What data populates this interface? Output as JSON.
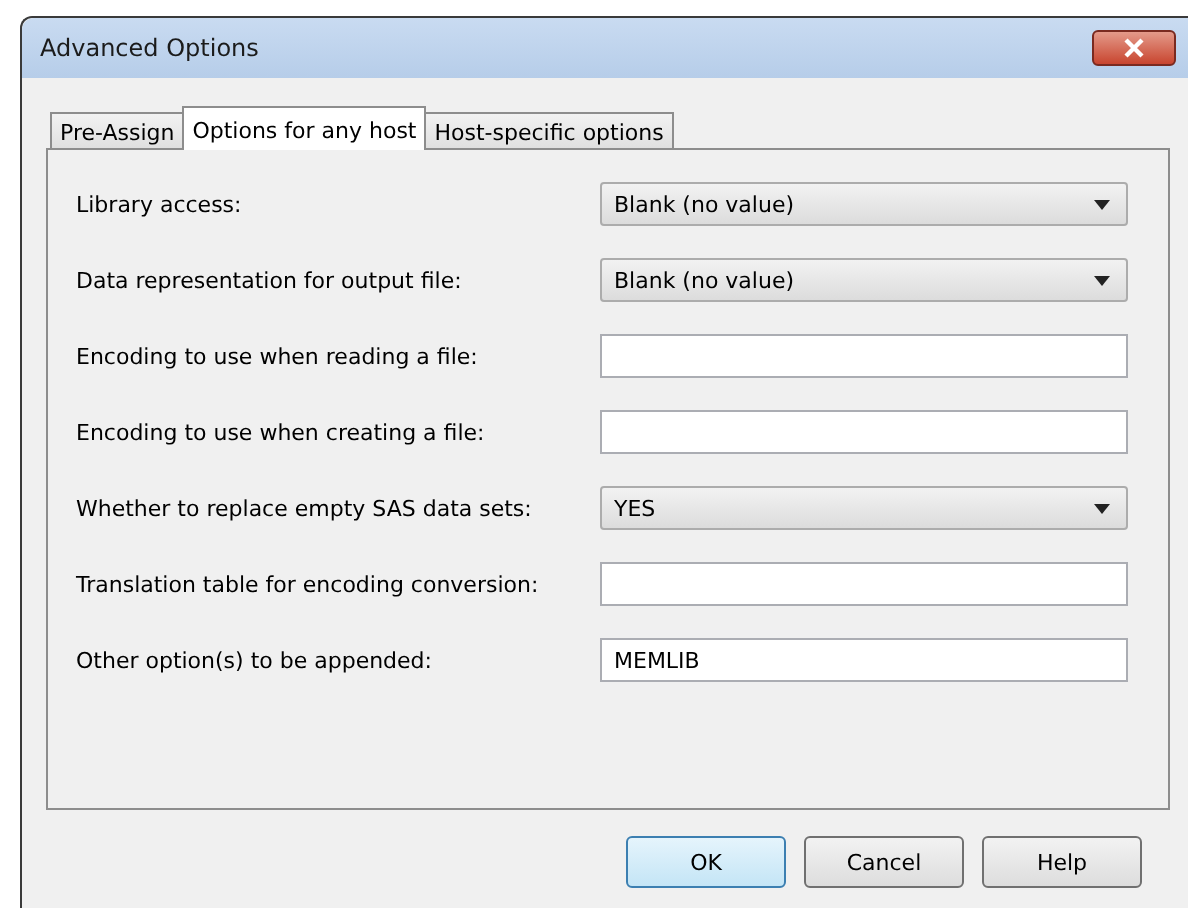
{
  "window": {
    "title": "Advanced Options"
  },
  "tabs": [
    {
      "label": "Pre-Assign",
      "selected": false
    },
    {
      "label": "Options for any host",
      "selected": true
    },
    {
      "label": "Host-specific options",
      "selected": false
    }
  ],
  "fields": [
    {
      "label": "Library access:",
      "kind": "dropdown",
      "value": "Blank (no value)"
    },
    {
      "label": "Data representation for output file:",
      "kind": "dropdown",
      "value": "Blank (no value)"
    },
    {
      "label": "Encoding to use when reading a file:",
      "kind": "text"
    },
    {
      "label": "Encoding to use when creating a file:",
      "kind": "text"
    },
    {
      "label": "Whether to replace empty SAS data sets:",
      "kind": "dropdown",
      "value": "YES"
    },
    {
      "label": "Translation table for encoding conversion:",
      "kind": "text"
    },
    {
      "label": "Other option(s) to be appended:",
      "kind": "text",
      "value": "MEMLIB"
    }
  ],
  "buttons": [
    {
      "label": "OK",
      "default": true
    },
    {
      "label": "Cancel",
      "default": false
    },
    {
      "label": "Help",
      "default": false
    }
  ]
}
